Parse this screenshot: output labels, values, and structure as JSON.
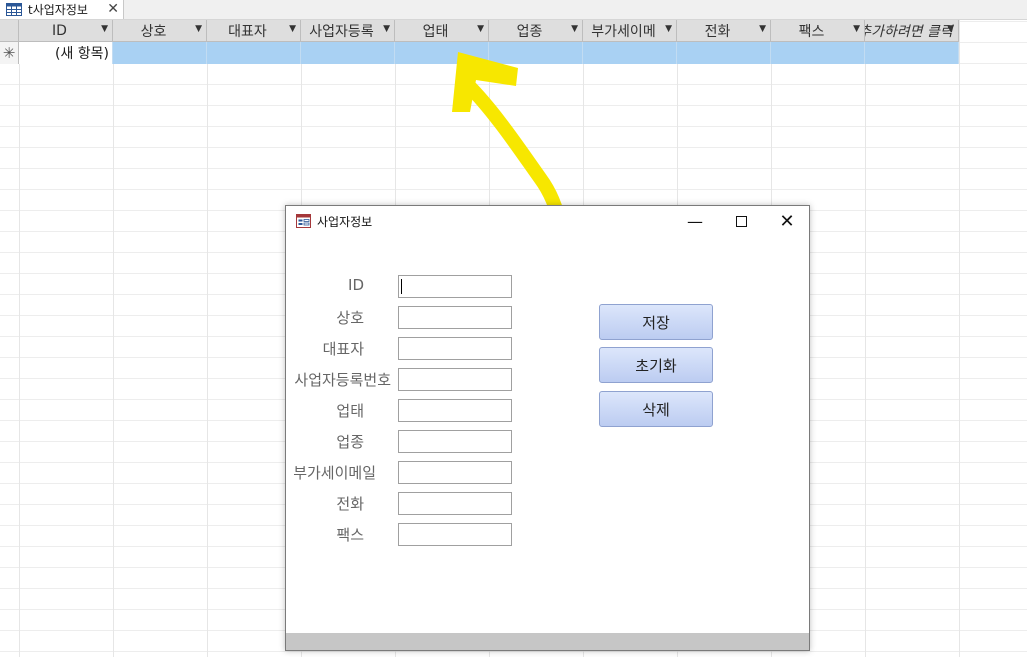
{
  "tab": {
    "label": "t사업자정보",
    "close": "✕",
    "icon": "table-icon"
  },
  "datasheet": {
    "columns": [
      "ID",
      "상호",
      "대표자",
      "사업자등록",
      "업태",
      "업종",
      "부가세이메",
      "전화",
      "팩스",
      "추가하려면 클릭"
    ],
    "new_row_marker": "✳",
    "new_row_text": "(새 항목)"
  },
  "annotation": {
    "shape": "curved-arrow",
    "color": "#f7e700"
  },
  "form": {
    "title": "사업자정보",
    "icon": "form-icon",
    "controls": {
      "minimize": "—",
      "close": "✕"
    },
    "fields": [
      "ID",
      "상호",
      "대표자",
      "사업자등록번호",
      "업태",
      "업종",
      "부가세이메일",
      "전화",
      "팩스"
    ],
    "buttons": {
      "save": "저장",
      "reset": "초기화",
      "delete": "삭제"
    }
  }
}
